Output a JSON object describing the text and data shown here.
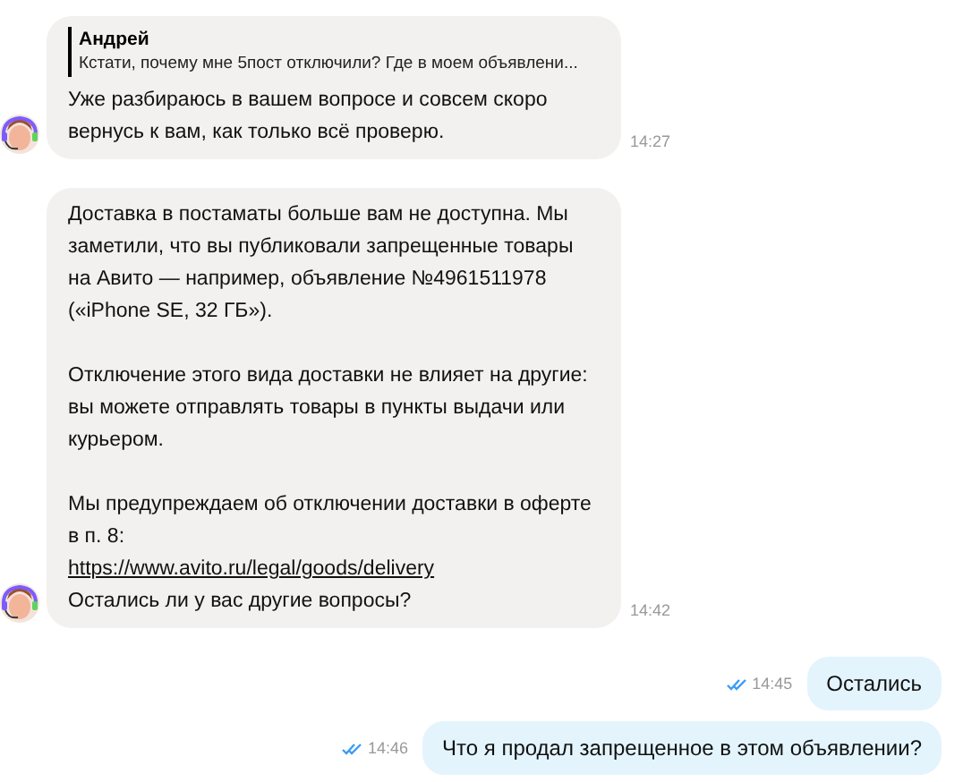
{
  "messages": [
    {
      "kind": "in",
      "quote": {
        "author": "Андрей",
        "text": "Кстати, почему мне 5пост отключили? Где в моем объявлени..."
      },
      "paragraphs": [
        [
          {
            "kind": "text",
            "text": "Уже разбираюсь в вашем вопросе и совсем скоро вернусь к вам, как только всё проверю."
          }
        ]
      ],
      "time": "14:27"
    },
    {
      "kind": "in",
      "paragraphs": [
        [
          {
            "kind": "text",
            "text": "Доставка в постаматы больше вам не доступна. Мы заметили, что вы публиковали запрещенные товары на Авито — например, объявление №4961511978 («iPhone SE, 32 ГБ»)."
          }
        ],
        [
          {
            "kind": "text",
            "text": "Отключение этого вида доставки не влияет на другие: вы можете отправлять товары в пункты выдачи или курьером."
          }
        ],
        [
          {
            "kind": "text",
            "text": "Мы предупреждаем об отключении доставки в оферте в п. 8:"
          },
          {
            "kind": "link",
            "text": "https://www.avito.ru/legal/goods/delivery"
          },
          {
            "kind": "text",
            "text": "Остались ли у вас другие вопросы?"
          }
        ]
      ],
      "time": "14:42"
    },
    {
      "kind": "out",
      "read": true,
      "paragraphs": [
        [
          {
            "kind": "text",
            "text": "Остались"
          }
        ]
      ],
      "time": "14:45"
    },
    {
      "kind": "out",
      "read": true,
      "paragraphs": [
        [
          {
            "kind": "text",
            "text": "Что я продал запрещенное в этом объявлении?"
          }
        ]
      ],
      "time": "14:46"
    }
  ]
}
